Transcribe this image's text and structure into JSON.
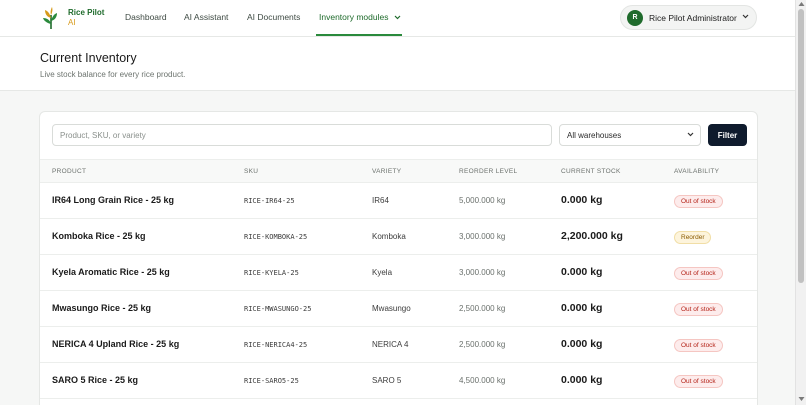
{
  "brand": {
    "line1": "Rice Pilot",
    "line2": "AI"
  },
  "nav": [
    {
      "label": "Dashboard"
    },
    {
      "label": "AI Assistant"
    },
    {
      "label": "AI Documents"
    },
    {
      "label": "Inventory modules"
    }
  ],
  "user": {
    "initial": "R",
    "name": "Rice Pilot Administrator"
  },
  "page": {
    "title": "Current Inventory",
    "subtitle": "Live stock balance for every rice product."
  },
  "filters": {
    "search_placeholder": "Product, SKU, or variety",
    "warehouse": "All warehouses",
    "filter_label": "Filter"
  },
  "table": {
    "headers": [
      "PRODUCT",
      "SKU",
      "VARIETY",
      "REORDER LEVEL",
      "CURRENT STOCK",
      "AVAILABILITY"
    ],
    "rows": [
      {
        "product": "IR64 Long Grain Rice - 25 kg",
        "sku": "RICE-IR64-25",
        "variety": "IR64",
        "reorder": "5,000.000 kg",
        "stock": "0.000 kg",
        "availability": "Out of stock"
      },
      {
        "product": "Komboka Rice - 25 kg",
        "sku": "RICE-KOMBOKA-25",
        "variety": "Komboka",
        "reorder": "3,000.000 kg",
        "stock": "2,200.000 kg",
        "availability": "Reorder"
      },
      {
        "product": "Kyela Aromatic Rice - 25 kg",
        "sku": "RICE-KYELA-25",
        "variety": "Kyela",
        "reorder": "3,000.000 kg",
        "stock": "0.000 kg",
        "availability": "Out of stock"
      },
      {
        "product": "Mwasungo Rice - 25 kg",
        "sku": "RICE-MWASUNGO-25",
        "variety": "Mwasungo",
        "reorder": "2,500.000 kg",
        "stock": "0.000 kg",
        "availability": "Out of stock"
      },
      {
        "product": "NERICA 4 Upland Rice - 25 kg",
        "sku": "RICE-NERICA4-25",
        "variety": "NERICA 4",
        "reorder": "2,500.000 kg",
        "stock": "0.000 kg",
        "availability": "Out of stock"
      },
      {
        "product": "SARO 5 Rice - 25 kg",
        "sku": "RICE-SARO5-25",
        "variety": "SARO 5",
        "reorder": "4,500.000 kg",
        "stock": "0.000 kg",
        "availability": "Out of stock"
      }
    ]
  },
  "colors": {
    "brand_green": "#1f6b2c",
    "brand_gold": "#d79a1a",
    "filter_button": "#0f1b2d",
    "out_of_stock": "#b42318",
    "reorder": "#8a5a00"
  },
  "icons": {
    "logo": "rice-plant-icon",
    "dropdown": "chevron-down-icon"
  }
}
